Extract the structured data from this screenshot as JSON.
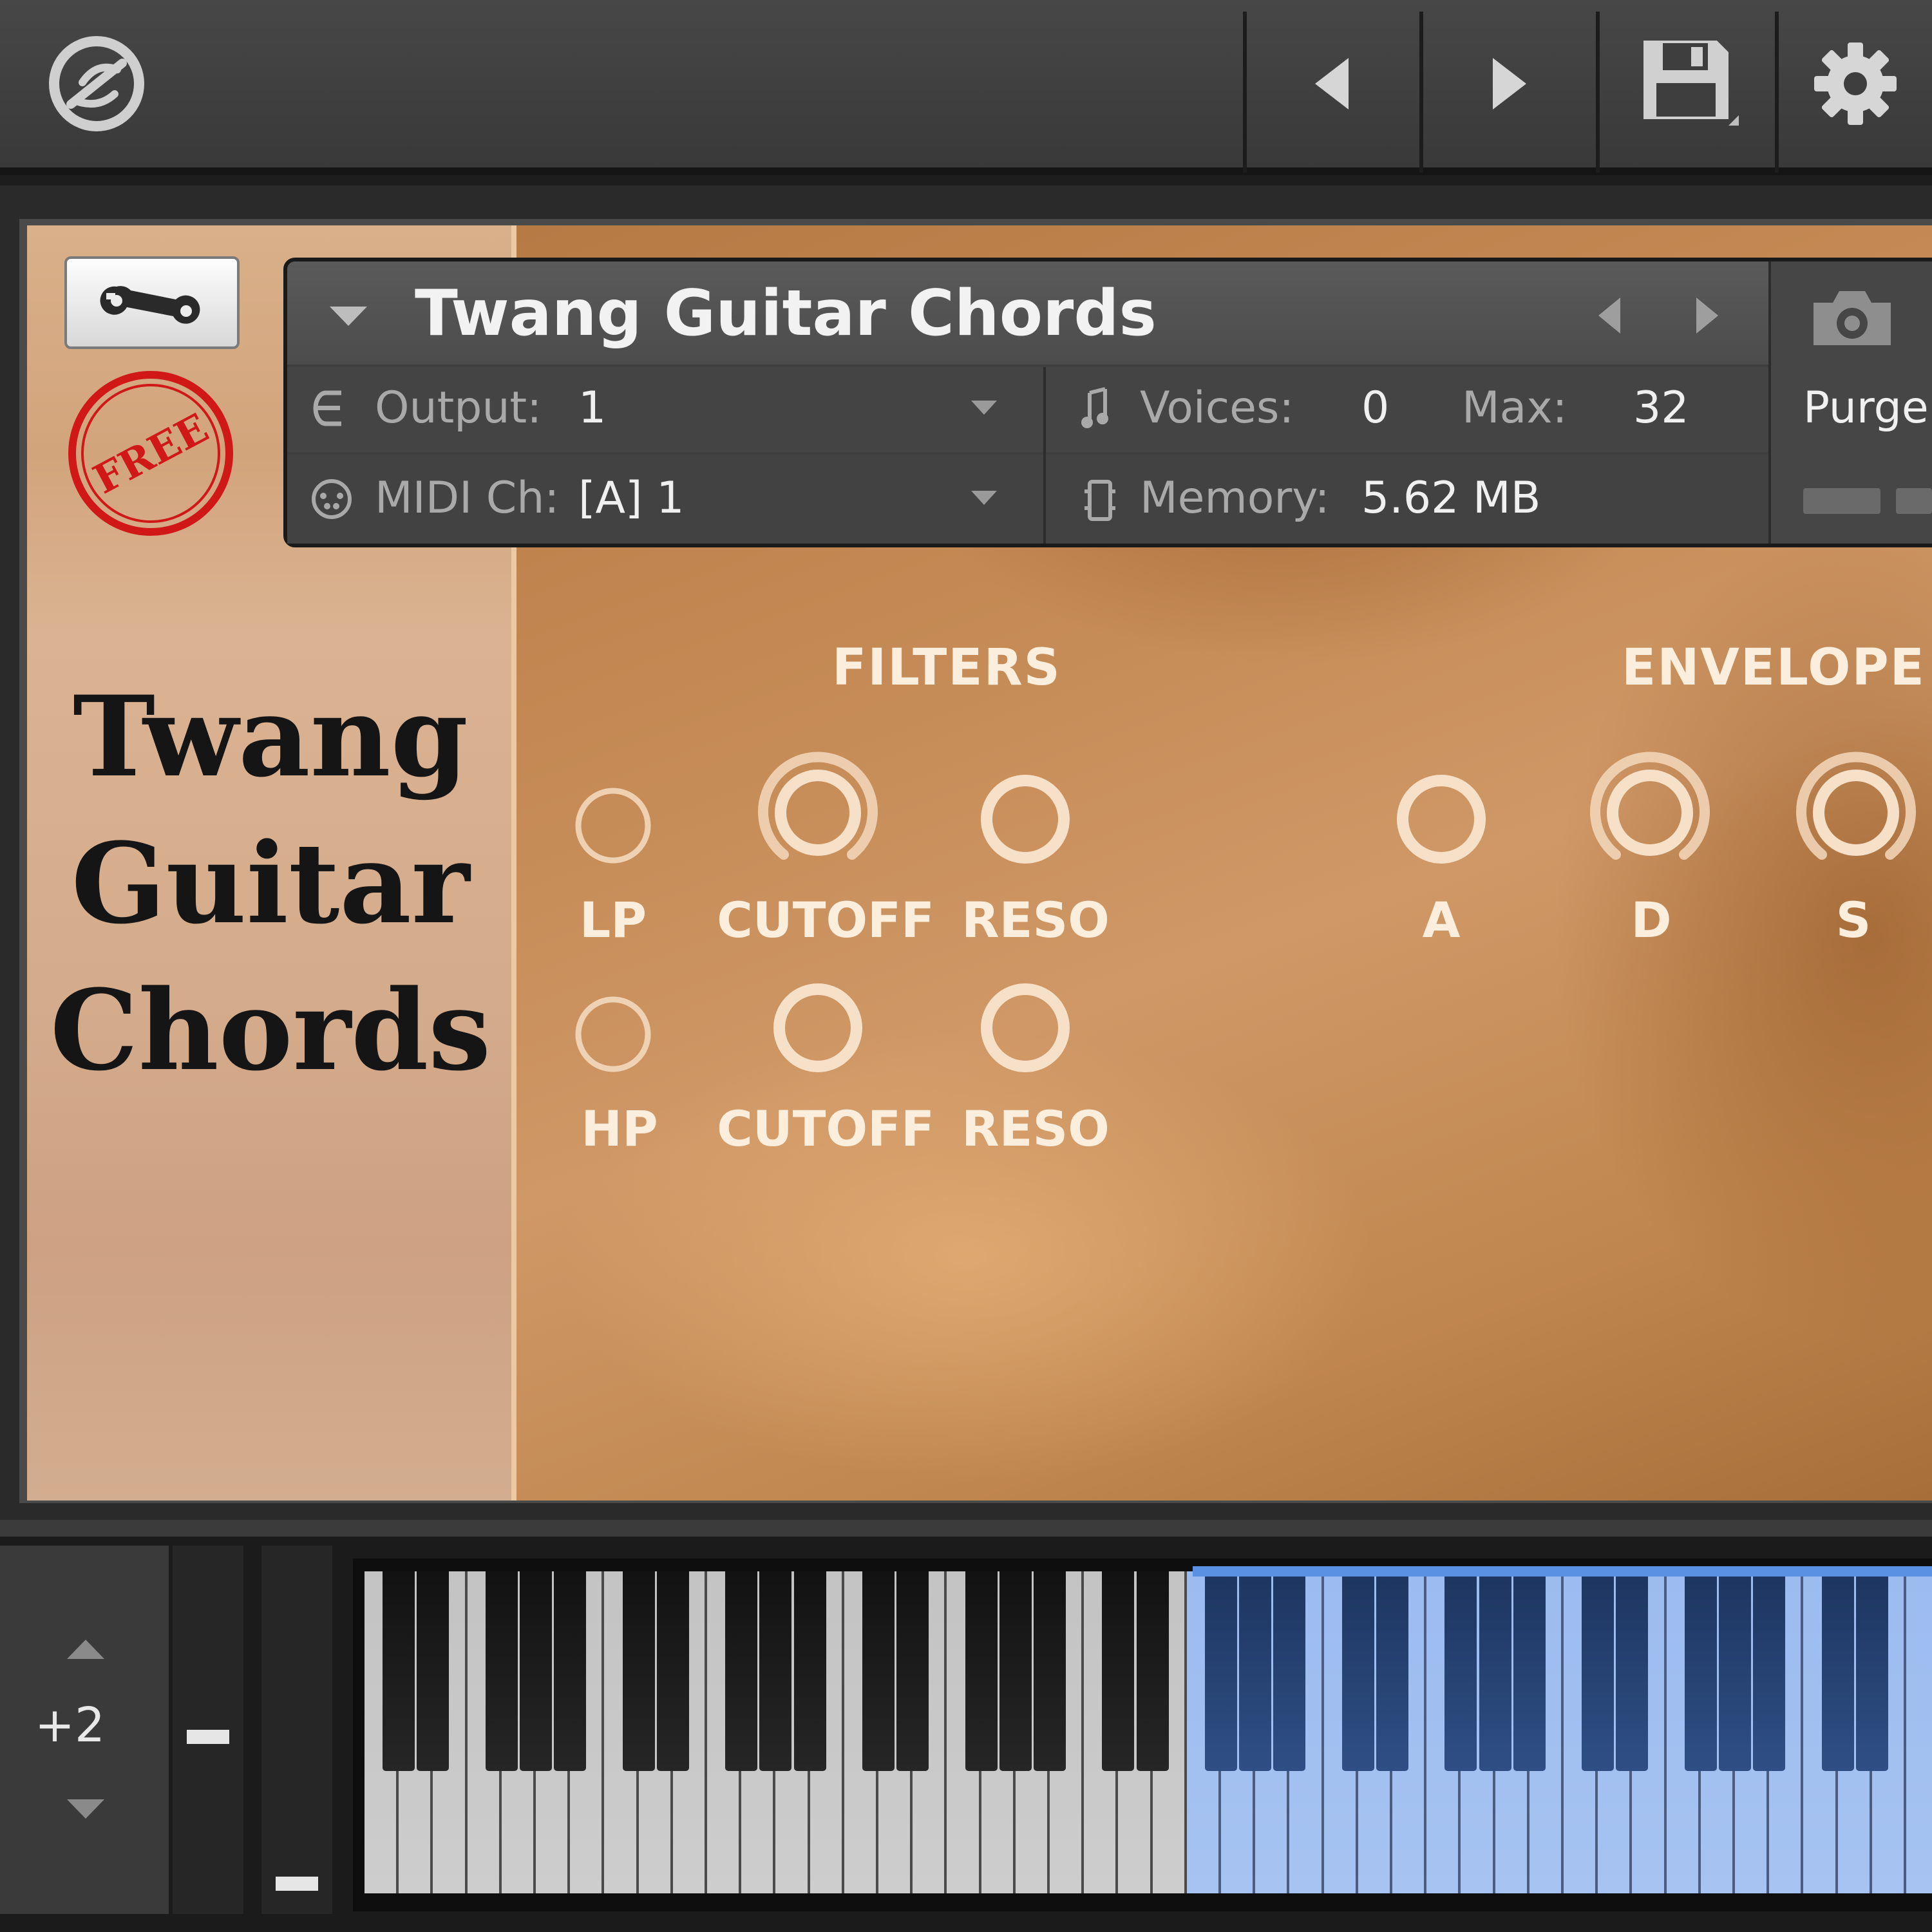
{
  "header": {
    "instrument_name": "Twang Guitar Chords",
    "output_label": "Output:",
    "output_value": "1",
    "midi_label": "MIDI Ch:",
    "midi_value": "[A]  1",
    "voices_label": "Voices:",
    "voices_value": "0",
    "max_label": "Max:",
    "max_value": "32",
    "memory_label": "Memory:",
    "memory_value": "5.62 MB",
    "purge_label": "Purge"
  },
  "panel": {
    "title_lines": [
      "Twang",
      "Guitar",
      "Chords"
    ],
    "free_stamp": "FREE"
  },
  "filters": {
    "title": "FILTERS",
    "lp_label": "LP",
    "hp_label": "HP",
    "cutoff_label": "CUTOFF",
    "reso_label": "RESO"
  },
  "envelope": {
    "title": "ENVELOPE",
    "a_label": "A",
    "d_label": "D",
    "s_label": "S"
  },
  "keyboard": {
    "octave_value": "+2"
  },
  "icons": {
    "logo": "kontakt-logo-icon",
    "prev": "arrow-left-icon",
    "next": "arrow-right-icon",
    "save": "floppy-disk-icon",
    "settings": "gear-icon",
    "wrench": "wrench-icon",
    "snapshot": "camera-icon"
  },
  "colors": {
    "panel_bg": "#c48954",
    "knob_ring": "#f3dcc2",
    "key_highlight": "#9cbbef",
    "stamp_red": "#d01818"
  }
}
